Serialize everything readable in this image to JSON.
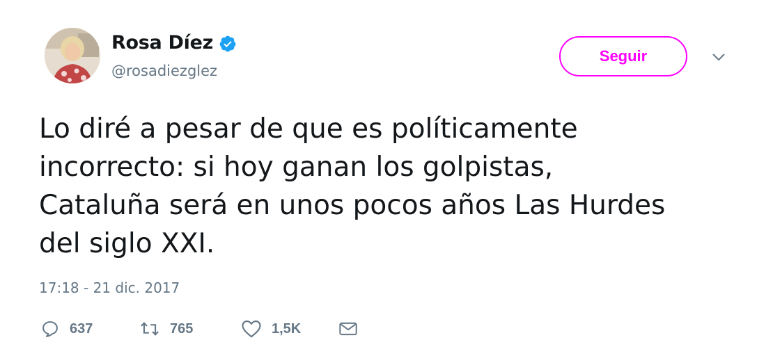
{
  "author": {
    "name": "Rosa Díez",
    "handle": "@rosadiezglez",
    "verified": true,
    "avatar_icon": "profile-photo"
  },
  "follow_button": {
    "label": "Seguir",
    "color": "#ff00ff"
  },
  "tweet": {
    "text": "Lo diré a pesar de que es políticamente\nincorrecto: si hoy ganan los golpistas,\nCataluña será en unos pocos años Las Hurdes\ndel siglo XXI.",
    "timestamp": "17:18 - 21 dic. 2017"
  },
  "actions": {
    "reply": {
      "icon": "reply-icon",
      "count": "637"
    },
    "retweet": {
      "icon": "retweet-icon",
      "count": "765"
    },
    "like": {
      "icon": "heart-icon",
      "count": "1,5K"
    },
    "message": {
      "icon": "envelope-icon"
    }
  },
  "colors": {
    "text": "#14171a",
    "secondary": "#657786",
    "verified": "#1da1f2",
    "accent": "#ff00ff"
  }
}
